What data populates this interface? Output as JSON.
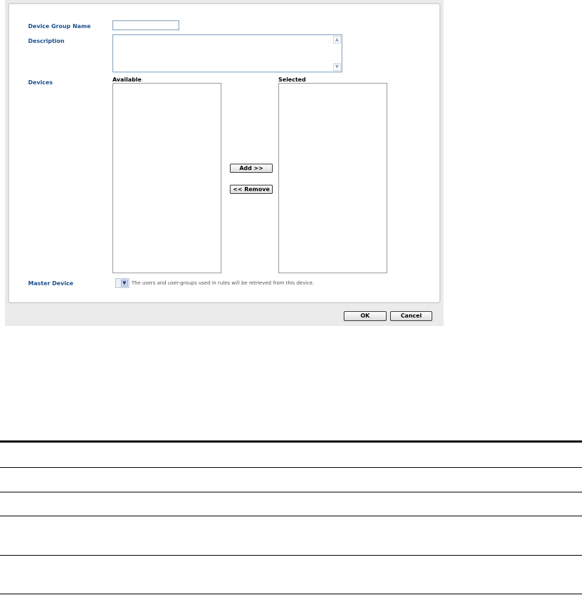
{
  "form": {
    "device_group_name_label": "Device Group Name",
    "device_group_name_value": "",
    "description_label": "Description",
    "description_value": "",
    "devices_label": "Devices",
    "available_header": "Available",
    "selected_header": "Selected",
    "add_button": "Add >>",
    "remove_button": "<< Remove",
    "master_device_label": "Master Device",
    "master_device_hint": "The users and user-groups used in rules will be retrieved from this device.",
    "master_device_value": ""
  },
  "footer": {
    "ok_button": "OK",
    "cancel_button": "Cancel"
  },
  "icons": {
    "scroll_up": "chevron-up-icon",
    "scroll_down": "chevron-down-icon",
    "dropdown": "chevron-down-icon"
  },
  "colors": {
    "label_blue": "#1c4f8f",
    "panel_border": "#d6d6d6",
    "outer_bg": "#ebebeb"
  }
}
